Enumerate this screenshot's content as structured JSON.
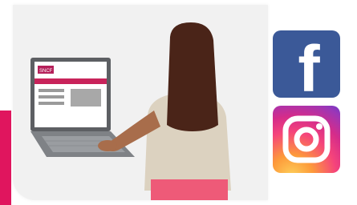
{
  "illustration": {
    "laptop_screen_logo": "SNCF"
  },
  "social": {
    "facebook": {
      "icon": "facebook-f-icon",
      "letter": "f",
      "color": "#3b5998"
    },
    "instagram": {
      "icon": "instagram-camera-icon"
    }
  },
  "colors": {
    "accent": "#e0155e",
    "skirt": "#ee5a78"
  }
}
